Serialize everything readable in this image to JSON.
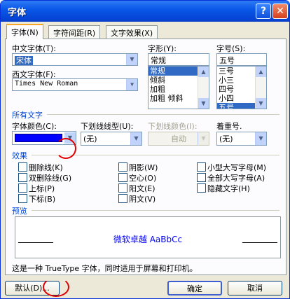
{
  "window": {
    "title": "字体",
    "help_glyph": "?",
    "close_glyph": "✕"
  },
  "tabs": [
    {
      "label": "字体(N)",
      "active": true
    },
    {
      "label": "字符间距(R)",
      "active": false
    },
    {
      "label": "文字效果(X)",
      "active": false
    }
  ],
  "font": {
    "chinese_label": "中文字体(T):",
    "chinese_value": "宋体",
    "western_label": "西文字体(F):",
    "western_value": "Times New Roman",
    "style_label": "字形(Y):",
    "style_value": "常规",
    "style_options": [
      "常规",
      "倾斜",
      "加粗",
      "加粗 倾斜"
    ],
    "style_selected_index": 0,
    "size_label": "字号(S):",
    "size_value": "五号",
    "size_options": [
      "三号",
      "小三",
      "四号",
      "小四",
      "五号"
    ],
    "size_selected_index": 4
  },
  "all_text": {
    "title": "所有文字",
    "color_label": "字体颜色(C):",
    "color_value": "#0000ff",
    "underline_label": "下划线线型(U):",
    "underline_value": "(无)",
    "underline_color_label": "下划线颜色(I):",
    "underline_color_value": "自动",
    "emphasis_label": "着重号.",
    "emphasis_value": "(无)"
  },
  "effects": {
    "title": "效果",
    "col1": [
      "删除线(K)",
      "双删除线(G)",
      "上标(P)",
      "下标(B)"
    ],
    "col2": [
      "阴影(W)",
      "空心(O)",
      "阳文(E)",
      "阴文(V)"
    ],
    "col3": [
      "小型大写字母(M)",
      "全部大写字母(A)",
      "隐藏文字(H)"
    ]
  },
  "preview": {
    "title": "预览",
    "sample": "微软卓越 AaBbCc",
    "note": "这是一种 TrueType 字体，同时适用于屏幕和打印机。"
  },
  "buttons": {
    "default": "默认(D)...",
    "ok": "确定",
    "cancel": "取消"
  },
  "icons": {
    "dropdown": "dropdown-arrow-icon",
    "scroll_up": "scroll-up-icon",
    "scroll_down": "scroll-down-icon"
  }
}
